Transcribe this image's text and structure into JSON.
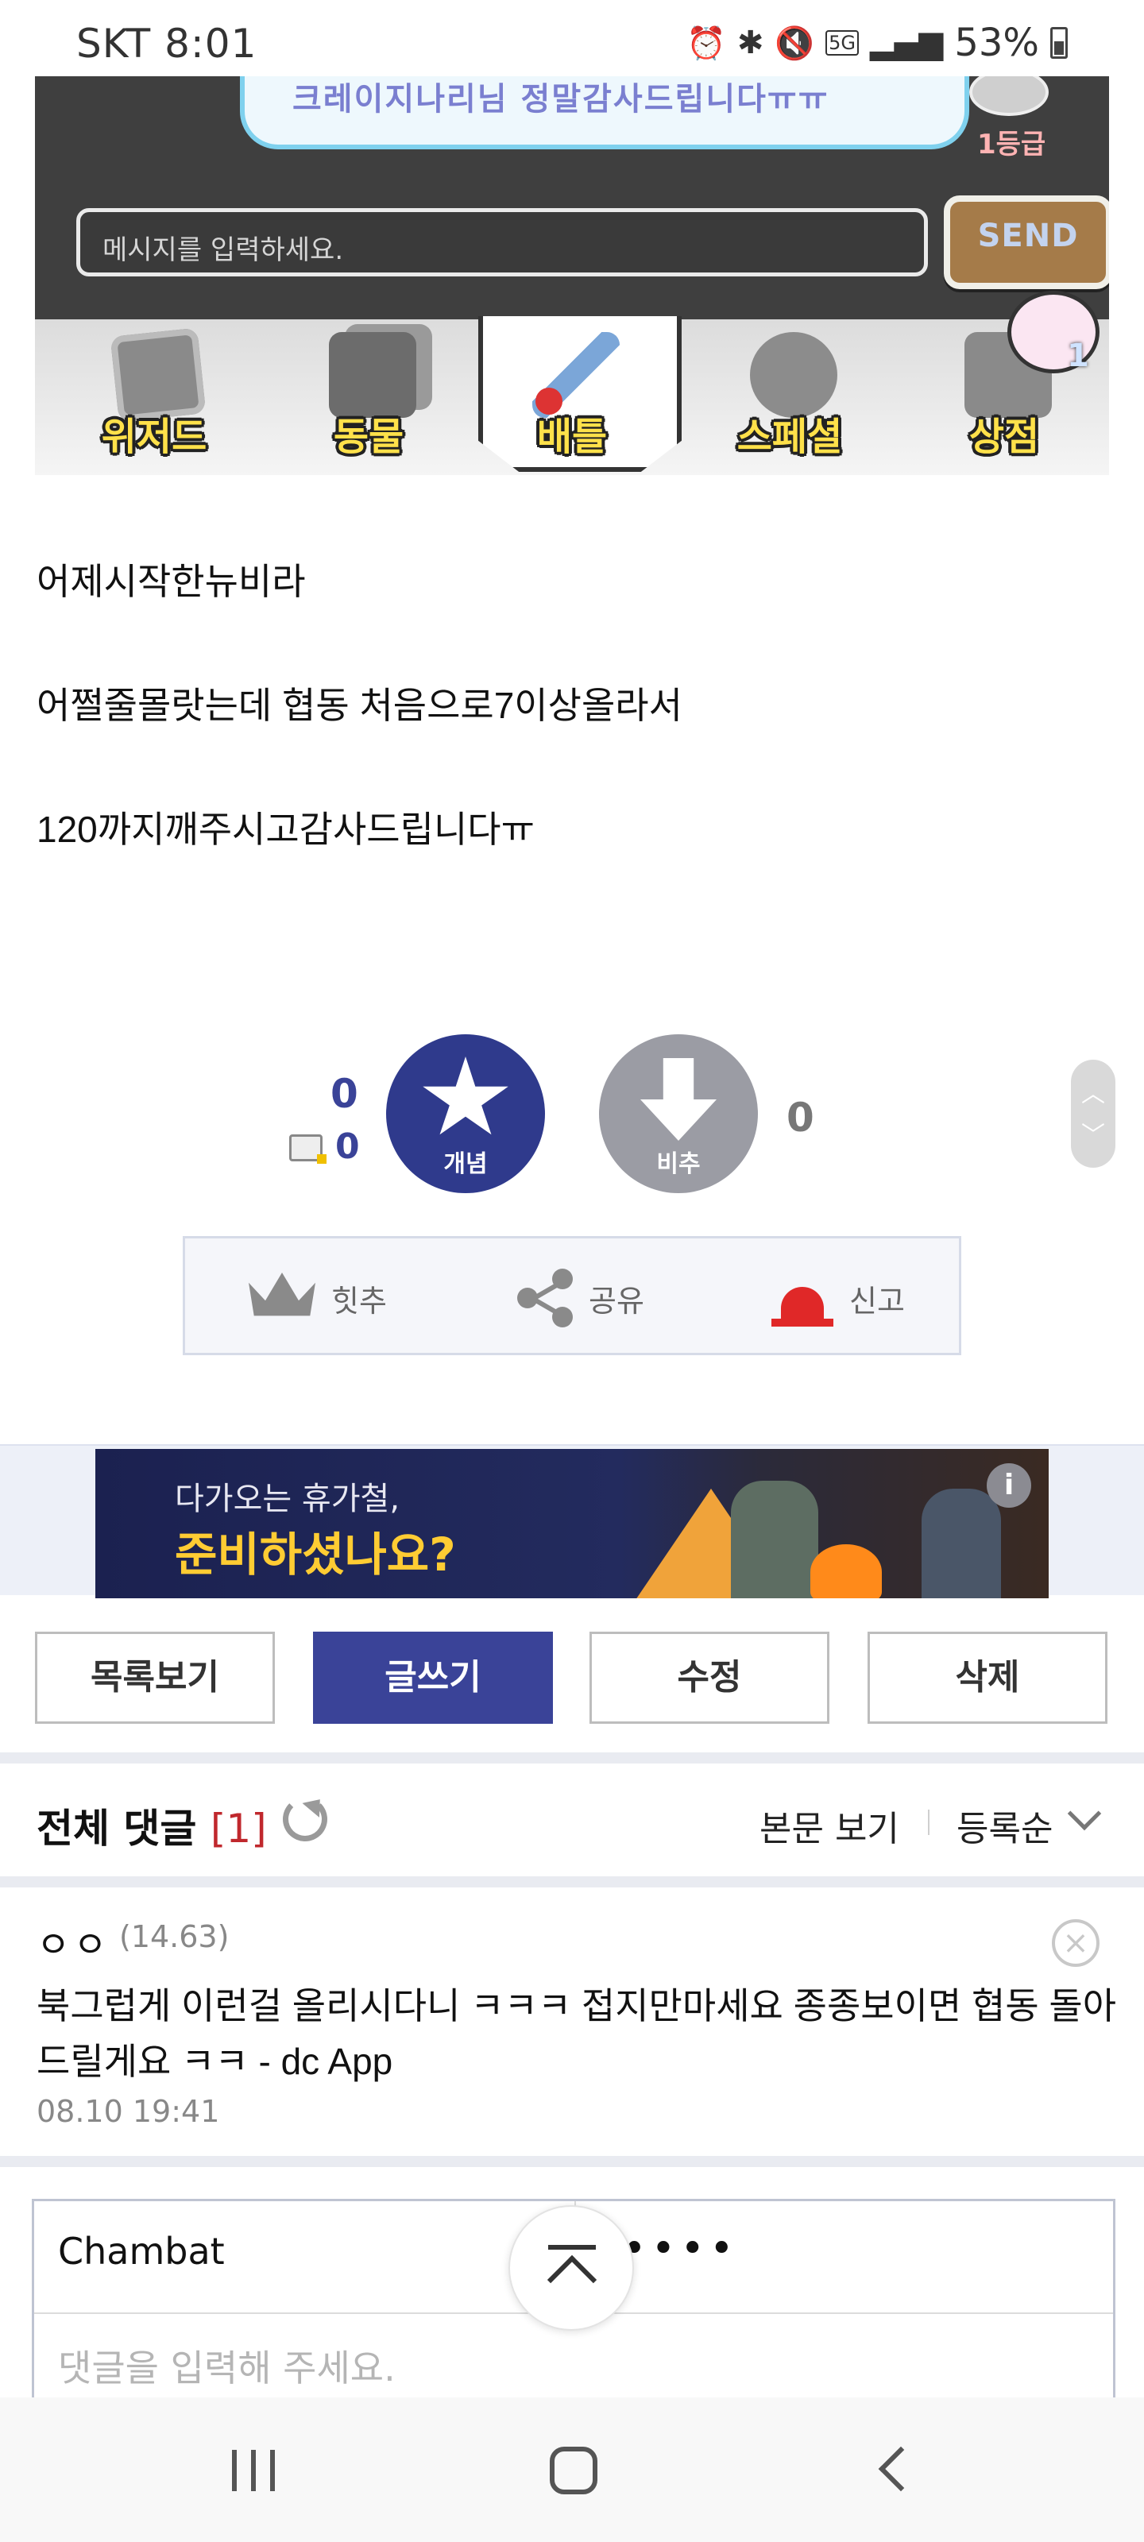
{
  "status_bar": {
    "carrier": "SKT",
    "time": "8:01",
    "network": "5G",
    "battery": "53%"
  },
  "game": {
    "chat_bubble": "크레이지나리님 정말감사드립니다ㅠㅠ",
    "grade": "1등급",
    "message_placeholder": "메시지를 입력하세요.",
    "send_label": "SEND",
    "tabs": [
      {
        "label": "위저드",
        "icon": "spellbook-icon"
      },
      {
        "label": "동물",
        "icon": "cards-icon"
      },
      {
        "label": "배틀",
        "icon": "sword-icon",
        "active": true
      },
      {
        "label": "스페셜",
        "icon": "orb-icon"
      },
      {
        "label": "상점",
        "icon": "shop-icon"
      }
    ],
    "avatar_level": "1"
  },
  "post": {
    "lines": [
      "어제시작한뉴비라",
      "어쩔줄몰랏는데 협동 처음으로7이상올라서",
      "120까지깨주시고감사드립니다ㅠ"
    ]
  },
  "vote": {
    "up_count": "0",
    "fixed_count": "0",
    "up_label": "개념",
    "down_label": "비추",
    "down_count": "0"
  },
  "actions": {
    "hit_label": "힛추",
    "share_label": "공유",
    "report_label": "신고"
  },
  "ad": {
    "line1": "다가오는 휴가철,",
    "line2": "준비하셨나요?",
    "info": "i"
  },
  "buttons": {
    "list": "목록보기",
    "write": "글쓰기",
    "edit": "수정",
    "delete": "삭제"
  },
  "comments": {
    "title": "전체 댓글",
    "count": "[1]",
    "view_post": "본문 보기",
    "sort": "등록순",
    "items": [
      {
        "author": "ㅇㅇ",
        "ip": "(14.63)",
        "text": "북그럽게 이런걸 올리시다니 ㅋㅋㅋ 접지만마세요 종종보이면 협동 돌아드릴게요 ㅋㅋ - dc App",
        "date": "08.10 19:41"
      }
    ]
  },
  "write_form": {
    "name": "Chambat",
    "password_mask": "••••",
    "placeholder": "댓글을 입력해 주세요."
  }
}
